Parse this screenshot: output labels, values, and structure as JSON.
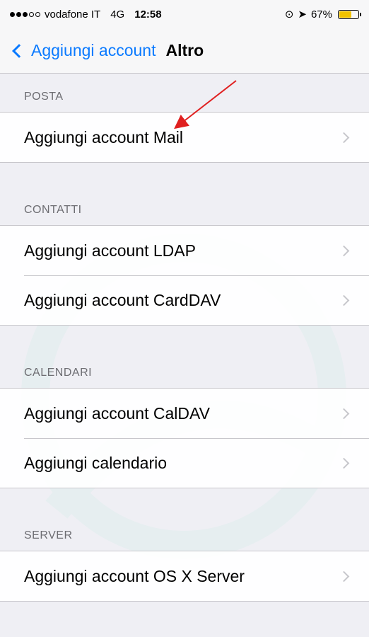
{
  "status_bar": {
    "carrier": "vodafone IT",
    "network": "4G",
    "time": "12:58",
    "battery_percent": "67%",
    "battery_level": 0.67,
    "battery_color": "#f2c300"
  },
  "nav": {
    "back_label": "Aggiungi account",
    "title": "Altro",
    "accent_color": "#0a7aff"
  },
  "sections": [
    {
      "header": "POSTA",
      "items": [
        "Aggiungi account Mail"
      ]
    },
    {
      "header": "CONTATTI",
      "items": [
        "Aggiungi account LDAP",
        "Aggiungi account CardDAV"
      ]
    },
    {
      "header": "CALENDARI",
      "items": [
        "Aggiungi account CalDAV",
        "Aggiungi calendario"
      ]
    },
    {
      "header": "SERVER",
      "items": [
        "Aggiungi account OS X Server"
      ]
    }
  ],
  "annotation": {
    "color": "#e02020"
  }
}
